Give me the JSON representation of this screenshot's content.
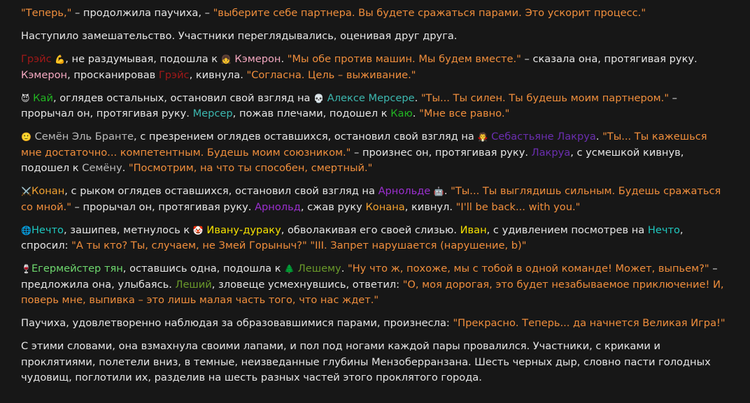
{
  "icons": {
    "grace": "💪",
    "cameron": "👧",
    "kai": "😈",
    "mercer": "💀",
    "semyon": "🙂",
    "lacroix": "🧛",
    "conan": "⚔️",
    "arnold": "🤖",
    "nechto": "🌐",
    "ivan": "🤡",
    "egermeister": "🍷",
    "leshy": "🌲"
  },
  "colors": {
    "quote": "#f08e3c",
    "text": "#e6e6e6",
    "background": "#171717",
    "grace": "#a01818",
    "cameron": "#f4a8c0",
    "kai": "#22b422",
    "mercer": "#3cb8b0",
    "semyon": "#b9b9b9",
    "lacroix": "#6b2eb0",
    "arnold": "#9b2fcf",
    "ivan": "#f5e000",
    "nechto": "#1fc8c0",
    "egermeister": "#6ed86e",
    "leshy": "#6a9a2a",
    "conan": "#f0a030"
  },
  "messages": {
    "p1": {
      "q1": "\"Теперь,\"",
      "t1": " – продолжила паучиха, – ",
      "q2": "\"выберите себе партнера. Вы будете сражаться парами. Это ускорит процесс.\""
    },
    "p2": {
      "t1": "Наступило замешательство. Участники переглядывались, оценивая друг друга."
    },
    "p3": {
      "grace": "Грэйс",
      "t1": ", не раздумывая, подошла к ",
      "cameron": "Кэмерон",
      "t2": ". ",
      "q1": "\"Мы обе против машин. Мы будем вместе.\"",
      "t3": " – сказала она, протягивая руку. ",
      "cameron2": "Кэмерон",
      "t4": ", просканировав ",
      "grace2": "Грэйс",
      "t5": ", кивнула. ",
      "q2": "\"Согласна. Цель – выживание.\""
    },
    "p4": {
      "kai": "Кай",
      "t1": ", оглядев остальных, остановил свой взгляд на ",
      "mercer": "Алексе Мерсере",
      "t2": ". ",
      "q1": "\"Ты... Ты силен. Ты будешь моим партнером.\"",
      "t3": " – прорычал он, протягивая руку. ",
      "mercer2": "Мерсер",
      "t4": ", пожав плечами, подошел к ",
      "kai2": "Каю",
      "t5": ". ",
      "q2": "\"Мне все равно.\""
    },
    "p5": {
      "semyon": "Семён Эль Бранте",
      "t1": ", с презрением оглядев оставшихся, остановил свой взгляд на ",
      "lacroix": "Себастьяне Лакруа",
      "t2": ". ",
      "q1": "\"Ты... Ты кажешься мне достаточно... компетентным. Будешь моим союзником.\"",
      "t3": " – произнес он, протягивая руку. ",
      "lacroix2": "Лакруа",
      "t4": ", с усмешкой кивнув, подошел к ",
      "semyon2": "Семёну",
      "t5": ". ",
      "q2": "\"Посмотрим, на что ты способен, смертный.\""
    },
    "p6": {
      "conan": "Конан",
      "t1": ", с рыком оглядев оставшихся, остановил свой взгляд на ",
      "arnold": "Арнольде",
      "t2": ". ",
      "q1": "\"Ты... Ты выглядишь сильным. Будешь сражаться со мной.\"",
      "t3": " – прорычал он, протягивая руку. ",
      "arnold2": "Арнольд",
      "t4": ", сжав руку ",
      "conan2": "Конана",
      "t5": ", кивнул. ",
      "q2": "\"I'll be back... with you.\""
    },
    "p7": {
      "nechto": "Нечто",
      "t1": ", зашипев, метнулось к ",
      "ivan": "Ивану-дураку",
      "t2": ", обволакивая его своей слизью. ",
      "ivan2": "Иван",
      "t3": ", с удивлением посмотрев на ",
      "nechto2": "Нечто",
      "t4": ", спросил: ",
      "q1": "\"А ты кто? Ты, случаем, не Змей Горыныч?\"",
      "t5": " ",
      "q2": "\"III. Запрет нарушается (нарушение, b)\""
    },
    "p8": {
      "egermeister": "Егермейстер тян",
      "t1": ", оставшись одна, подошла к ",
      "leshy": "Лешему",
      "t2": ". ",
      "q1": "\"Ну что ж, похоже, мы с тобой в одной команде! Может, выпьем?\"",
      "t3": " – предложила она, улыбаясь. ",
      "leshy2": "Леший",
      "t4": ", зловеще усмехнувшись, ответил: ",
      "q2": "\"О, моя дорогая, это будет незабываемое приключение! И, поверь мне, выпивка – это лишь малая часть того, что нас ждет.\""
    },
    "p9": {
      "t1": "Паучиха, удовлетворенно наблюдая за образовавшимися парами, произнесла: ",
      "q1": "\"Прекрасно. Теперь... да начнется Великая Игра!\""
    },
    "p10": {
      "t1": "С этими словами, она взмахнула своими лапами, и пол под ногами каждой пары провалился. Участники, с криками и проклятиями, полетели вниз, в темные, неизведанные глубины Мензоберранзана. Шесть черных дыр, словно пасти голодных чудовищ, поглотили их, разделив на шесть разных частей этого проклятого города."
    }
  }
}
